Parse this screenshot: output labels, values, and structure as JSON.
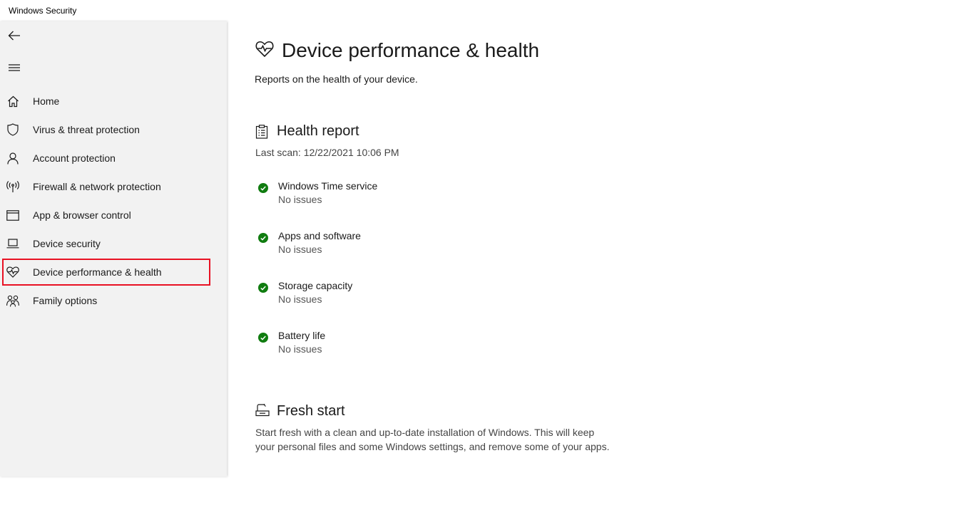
{
  "window": {
    "title": "Windows Security"
  },
  "sidebar": {
    "items": [
      {
        "label": "Home",
        "icon": "home-icon"
      },
      {
        "label": "Virus & threat protection",
        "icon": "shield-icon"
      },
      {
        "label": "Account protection",
        "icon": "person-icon"
      },
      {
        "label": "Firewall & network protection",
        "icon": "antenna-icon"
      },
      {
        "label": "App & browser control",
        "icon": "browser-window-icon"
      },
      {
        "label": "Device security",
        "icon": "laptop-icon"
      },
      {
        "label": "Device performance & health",
        "icon": "heart-pulse-icon",
        "selected": true
      },
      {
        "label": "Family options",
        "icon": "family-icon"
      }
    ]
  },
  "main": {
    "title": "Device performance & health",
    "subtitle": "Reports on the health of your device.",
    "health_report": {
      "title": "Health report",
      "last_scan": "Last scan: 12/22/2021 10:06 PM",
      "items": [
        {
          "name": "Windows Time service",
          "status": "No issues"
        },
        {
          "name": "Apps and software",
          "status": "No issues"
        },
        {
          "name": "Storage capacity",
          "status": "No issues"
        },
        {
          "name": "Battery life",
          "status": "No issues"
        }
      ]
    },
    "fresh_start": {
      "title": "Fresh start",
      "description": "Start fresh with a clean and up-to-date installation of Windows. This will keep your personal files and some Windows settings, and remove some of your apps."
    }
  },
  "colors": {
    "selection_border": "#e81123",
    "check_green": "#107c10",
    "sidebar_bg": "#f2f2f2"
  }
}
